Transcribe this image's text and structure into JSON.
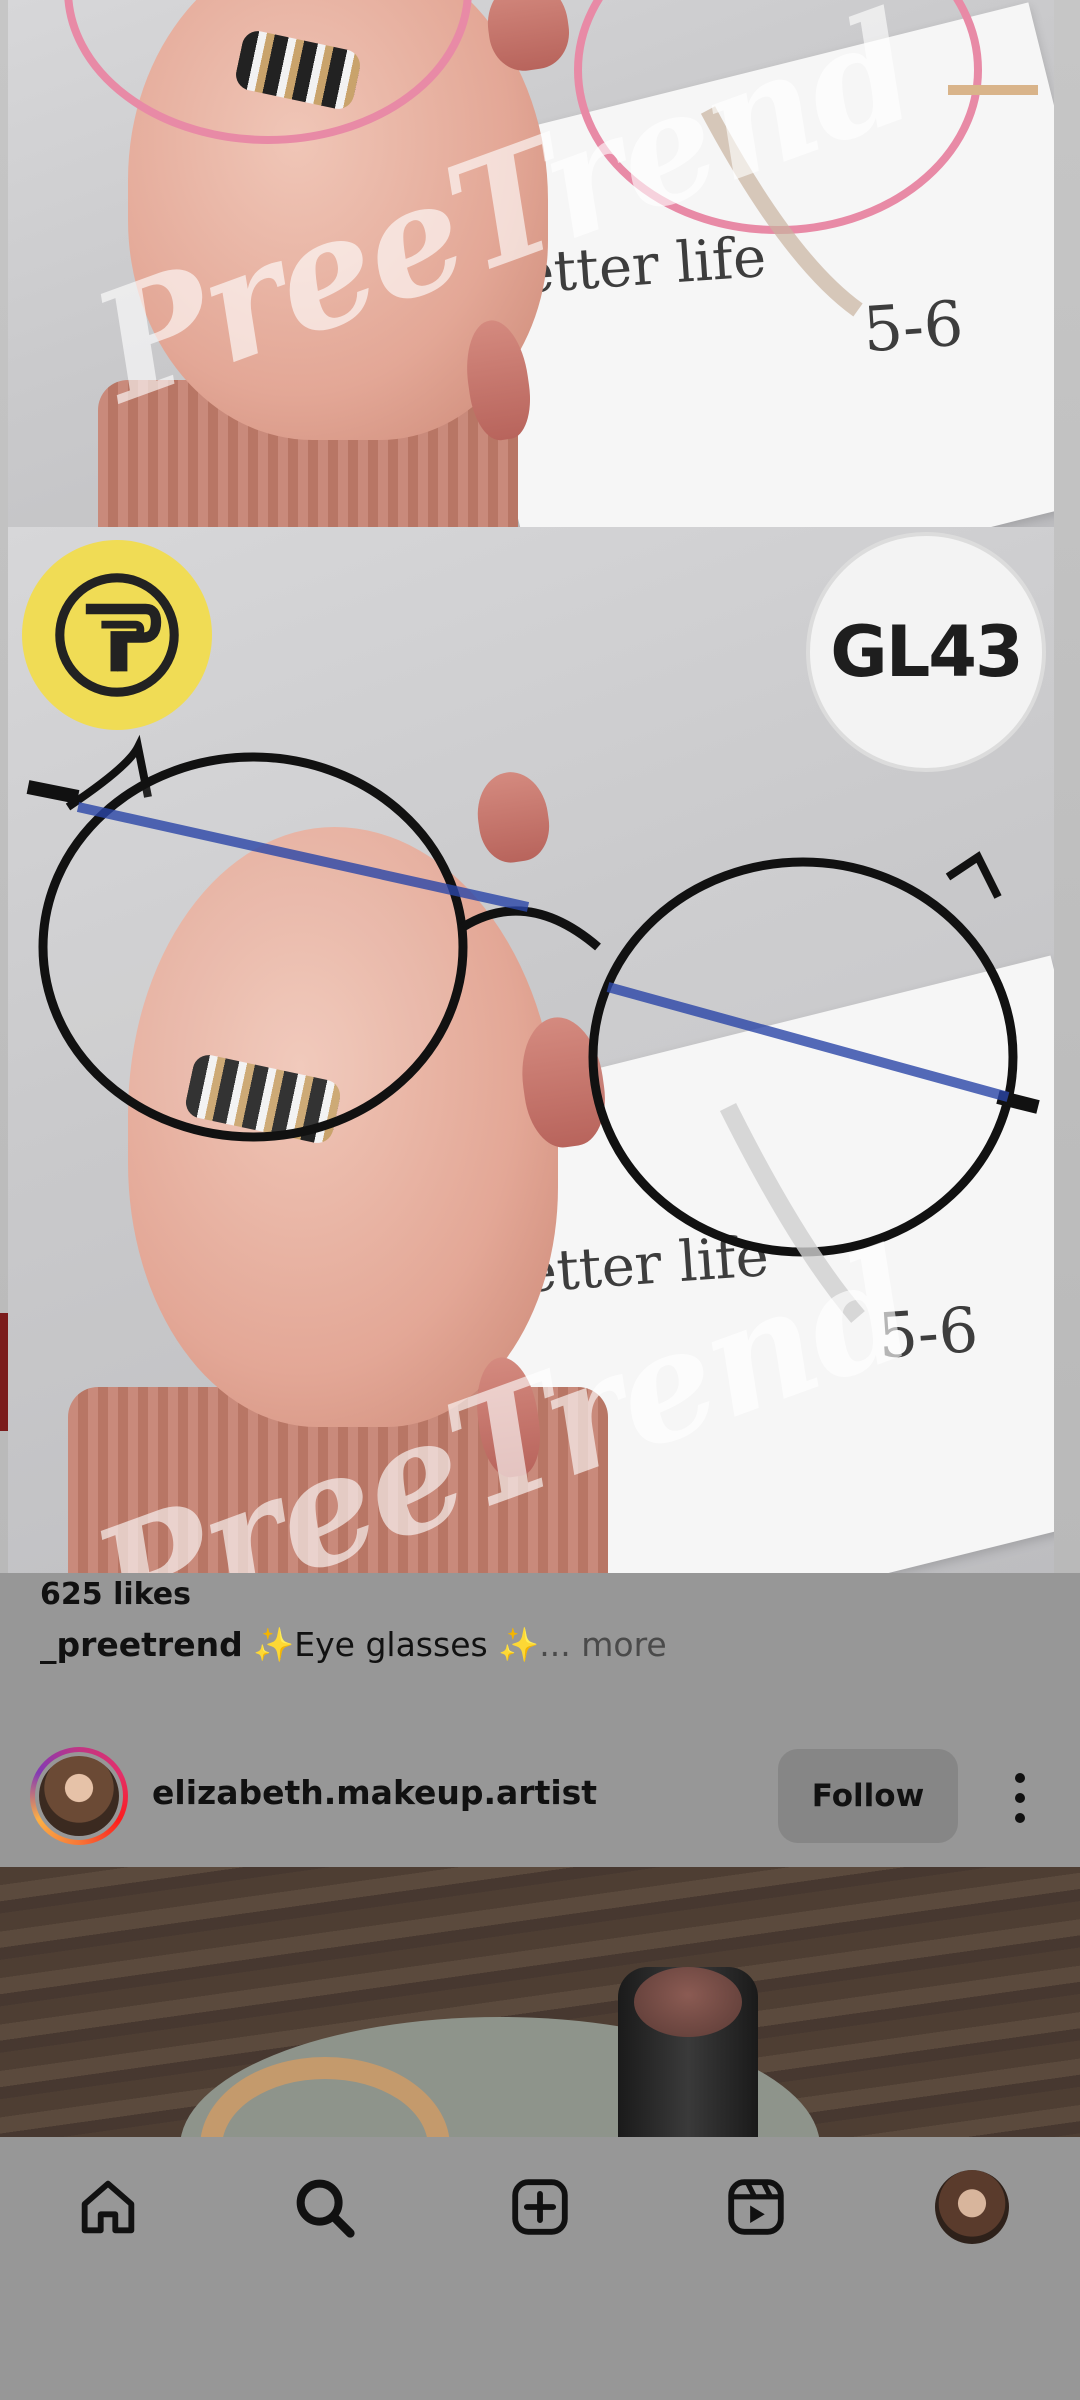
{
  "post": {
    "watermark": "PreeTrend",
    "product_code": "GL43",
    "card_text_1": "etter life",
    "card_text_2": "5-6",
    "likes": "625 likes",
    "caption_user": "_preetrend",
    "caption_text": " ✨Eye glasses ✨",
    "caption_more": "... more"
  },
  "next_post": {
    "username": "elizabeth.makeup.artist",
    "follow_label": "Follow"
  },
  "nav": {
    "items": [
      "home-icon",
      "search-icon",
      "create-icon",
      "reels-icon",
      "profile-avatar"
    ]
  },
  "colors": {
    "overlay": "#979797",
    "logo_badge": "#f0dc55",
    "story_ring": "#e1306c"
  }
}
